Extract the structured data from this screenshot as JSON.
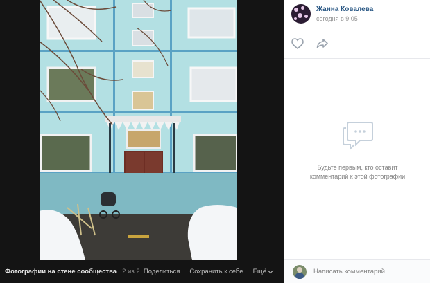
{
  "author": {
    "name": "Жанна Ковалева",
    "time": "сегодня в 9:05"
  },
  "empty_state": {
    "text": "Будьте первым, кто оставит комментарий к этой фотографии"
  },
  "composer": {
    "placeholder": "Написать комментарий..."
  },
  "footer": {
    "album_link": "Фотографии на стене сообщества",
    "counter": "2 из 2",
    "share_label": "Поделиться",
    "save_label": "Сохранить к себе",
    "more_label": "Ещё"
  },
  "colors": {
    "link": "#2a5885",
    "viewer_bg": "#141414",
    "icon_gray": "#99a2ad"
  },
  "icons": {
    "like": "heart-icon",
    "share": "share-arrow-icon",
    "empty": "comment-bubble-icon",
    "more": "chevron-down-icon"
  }
}
